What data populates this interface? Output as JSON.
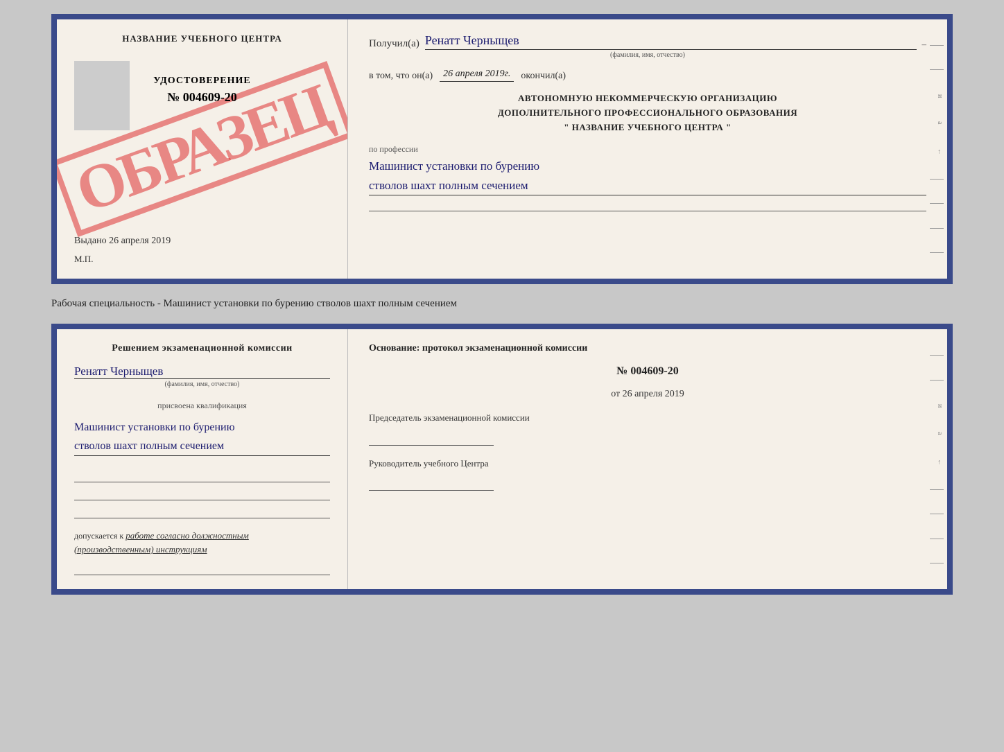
{
  "top_left": {
    "header": "НАЗВАНИЕ УЧЕБНОГО ЦЕНТРА",
    "stamp_text": "ОБРАЗЕЦ",
    "udostoverenie_label": "УДОСТОВЕРЕНИЕ",
    "number": "№ 004609-20",
    "vydano_label": "Выдано",
    "vydano_date": "26 апреля 2019",
    "mp_label": "М.П."
  },
  "top_right": {
    "poluchil_label": "Получил(а)",
    "recipient_name": "Ренатт Черныщев",
    "fio_sublabel": "(фамилия, имя, отчество)",
    "vtom_label": "в том, что он(а)",
    "date_value": "26 апреля 2019г.",
    "okonchil_label": "окончил(а)",
    "org_line1": "АВТОНОМНУЮ НЕКОММЕРЧЕСКУЮ ОРГАНИЗАЦИЮ",
    "org_line2": "ДОПОЛНИТЕЛЬНОГО ПРОФЕССИОНАЛЬНОГО ОБРАЗОВАНИЯ",
    "org_line3": "\"   НАЗВАНИЕ УЧЕБНОГО ЦЕНТРА   \"",
    "po_professii_label": "по профессии",
    "profession_line1": "Машинист установки по бурению",
    "profession_line2": "стволов шахт полным сечением"
  },
  "middle": {
    "text": "Рабочая специальность - Машинист установки по бурению стволов шахт полным сечением"
  },
  "bottom_left": {
    "resheniem_label": "Решением экзаменационной комиссии",
    "recipient_name": "Ренатт Черныщев",
    "fio_sublabel": "(фамилия, имя, отчество)",
    "prisvoena_label": "присвоена квалификация",
    "qual_line1": "Машинист установки по бурению",
    "qual_line2": "стволов шахт полным сечением",
    "dopuskaetsya_label": "допускается к",
    "dopuskaetsya_text": "работе согласно должностным (производственным) инструкциям"
  },
  "bottom_right": {
    "osnovanie_label": "Основание: протокол экзаменационной комиссии",
    "protocol_num": "№ 004609-20",
    "ot_label": "от",
    "ot_date": "26 апреля 2019",
    "predsedatel_label": "Председатель экзаменационной комиссии",
    "rukovoditel_label": "Руководитель учебного Центра"
  },
  "edge_labels": {
    "i": "и",
    "a": "а",
    "arrow": "←"
  }
}
